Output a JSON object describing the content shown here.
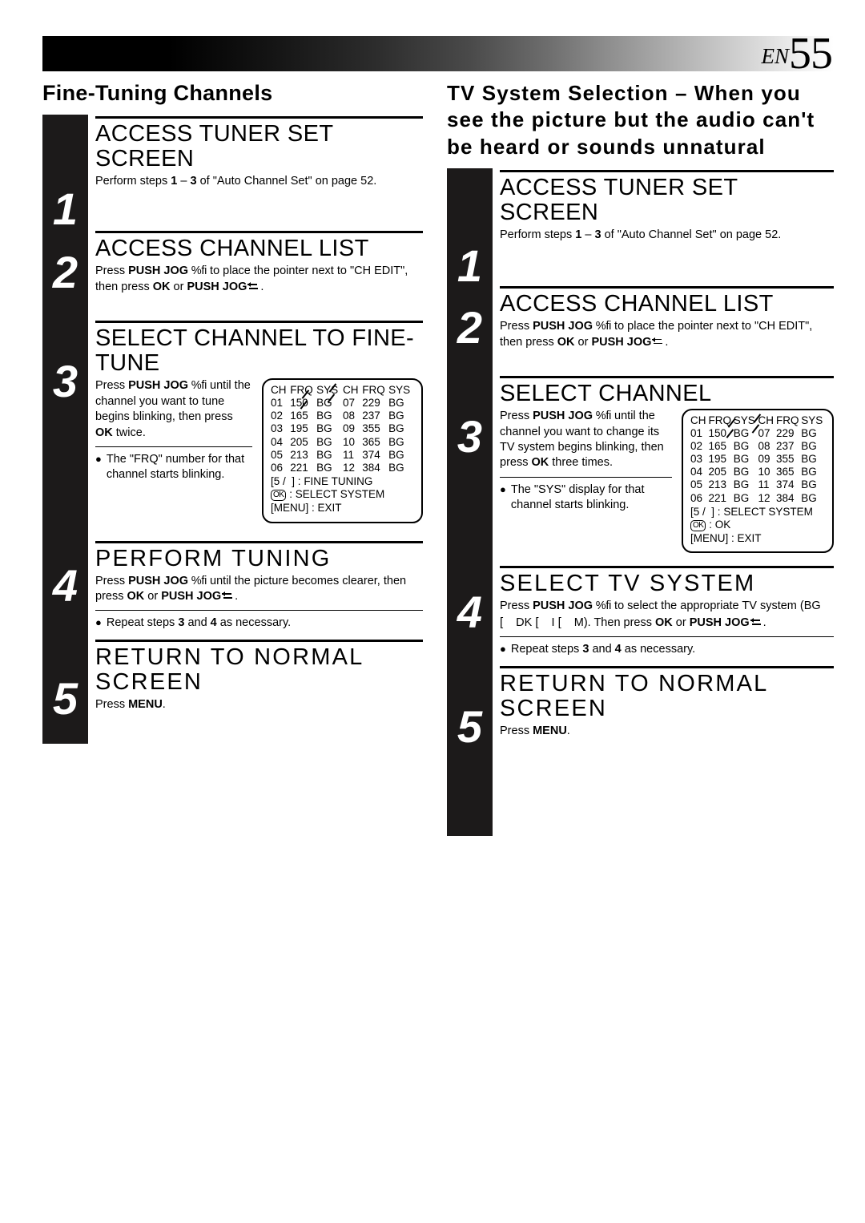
{
  "header": {
    "lang_code": "EN",
    "page_number": "55"
  },
  "columns": {
    "left": {
      "title": "Fine-Tuning Channels",
      "steps": [
        {
          "number": "1",
          "heading": "ACCESS TUNER SET SCREEN",
          "text_parts": {
            "a": "Perform steps ",
            "b": "1",
            "c": " – ",
            "d": "3",
            "e": " of \"Auto Channel Set\" on page 52."
          }
        },
        {
          "number": "2",
          "heading": "ACCESS CHANNEL LIST",
          "text_parts": {
            "a": "Press ",
            "b": "PUSH JOG",
            "c": " %fi",
            "d": " to place the pointer next to \"CH EDIT\", then press ",
            "e": "OK",
            "f": " or ",
            "g": "PUSH JOG",
            "h": "."
          }
        },
        {
          "number": "3",
          "heading": "SELECT CHANNEL TO FINE-TUNE",
          "text_parts": {
            "a": "Press ",
            "b": "PUSH JOG",
            "c": " %fi",
            "d": " until the channel you want to tune begins blinking, then press ",
            "e": "OK",
            "f": " twice."
          },
          "bullet": "The \"FRQ\" number for that channel starts blinking."
        },
        {
          "number": "4",
          "heading": "PERFORM TUNING",
          "text_parts": {
            "a": "Press ",
            "b": "PUSH JOG",
            "c": " %fi",
            "d": " until the picture becomes clearer, then press ",
            "e": "OK",
            "f": " or ",
            "g": "PUSH JOG",
            "h": "."
          },
          "bullet_parts": {
            "a": "Repeat steps ",
            "b": "3",
            "c": " and ",
            "d": "4",
            "e": " as necessary."
          }
        },
        {
          "number": "5",
          "heading": "RETURN TO NORMAL SCREEN",
          "text_parts": {
            "a": "Press ",
            "b": "MENU",
            "c": "."
          }
        }
      ]
    },
    "right": {
      "title": "TV System Selection – When you see the picture but the audio can't be heard or sounds unnatural",
      "steps": [
        {
          "number": "1",
          "heading": "ACCESS TUNER SET SCREEN",
          "text_parts": {
            "a": "Perform steps ",
            "b": "1",
            "c": " – ",
            "d": "3",
            "e": " of \"Auto Channel Set\" on page 52."
          }
        },
        {
          "number": "2",
          "heading": "ACCESS CHANNEL LIST",
          "text_parts": {
            "a": "Press ",
            "b": "PUSH JOG",
            "c": " %fi",
            "d": " to place the pointer next to \"CH EDIT\", then press ",
            "e": "OK",
            "f": " or ",
            "g": "PUSH JOG",
            "h": "."
          }
        },
        {
          "number": "3",
          "heading": "SELECT CHANNEL",
          "text_parts": {
            "a": "Press ",
            "b": "PUSH JOG",
            "c": " %fi",
            "d": " until the channel you want to change its TV system begins blinking, then press ",
            "e": "OK",
            "f": " three times."
          },
          "bullet": "The \"SYS\" display for that channel starts blinking."
        },
        {
          "number": "4",
          "heading": "SELECT TV SYSTEM",
          "text_parts": {
            "a": "Press ",
            "b": "PUSH JOG",
            "c": " %fi",
            "d": " to select the appropriate TV system (BG ",
            "d2": "[",
            "d3": "DK ",
            "d4": "[",
            "d5": "I ",
            "d6": "[",
            "d7": "M). Then press ",
            "e": "OK",
            "f": " or ",
            "g": "PUSH JOG",
            "h": "."
          },
          "bullet_parts": {
            "a": "Repeat steps ",
            "b": "3",
            "c": " and ",
            "d": "4",
            "e": " as necessary."
          }
        },
        {
          "number": "5",
          "heading": "RETURN TO NORMAL SCREEN",
          "text_parts": {
            "a": "Press ",
            "b": "MENU",
            "c": "."
          }
        }
      ]
    }
  },
  "osd_left": {
    "headers": [
      "CH",
      "FRQ",
      "SYS",
      "CH",
      "FRQ",
      "SYS"
    ],
    "rows": [
      [
        "01",
        "150",
        "BG",
        "07",
        "229",
        "BG"
      ],
      [
        "02",
        "165",
        "BG",
        "08",
        "237",
        "BG"
      ],
      [
        "03",
        "195",
        "BG",
        "09",
        "355",
        "BG"
      ],
      [
        "04",
        "205",
        "BG",
        "10",
        "365",
        "BG"
      ],
      [
        "05",
        "213",
        "BG",
        "11",
        "374",
        "BG"
      ],
      [
        "06",
        "221",
        "BG",
        "12",
        "384",
        "BG"
      ]
    ],
    "legend": [
      {
        "key": "[5 /",
        "key2": "] :",
        "label": "FINE TUNING",
        "icon": ""
      },
      {
        "key": "",
        "key2": ":",
        "label": "SELECT SYSTEM",
        "icon": "OK"
      },
      {
        "key": "[MENU] :",
        "key2": "",
        "label": "EXIT",
        "icon": ""
      }
    ]
  },
  "osd_right": {
    "headers": [
      "CH",
      "FRQ",
      "SYS",
      "CH",
      "FRQ",
      "SYS"
    ],
    "rows": [
      [
        "01",
        "150",
        "BG",
        "07",
        "229",
        "BG"
      ],
      [
        "02",
        "165",
        "BG",
        "08",
        "237",
        "BG"
      ],
      [
        "03",
        "195",
        "BG",
        "09",
        "355",
        "BG"
      ],
      [
        "04",
        "205",
        "BG",
        "10",
        "365",
        "BG"
      ],
      [
        "05",
        "213",
        "BG",
        "11",
        "374",
        "BG"
      ],
      [
        "06",
        "221",
        "BG",
        "12",
        "384",
        "BG"
      ]
    ],
    "legend": [
      {
        "key": "[5 /",
        "key2": "] :",
        "label": "SELECT SYSTEM",
        "icon": ""
      },
      {
        "key": "",
        "key2": ":",
        "label": "OK",
        "icon": "OK"
      },
      {
        "key": "[MENU] :",
        "key2": "",
        "label": "EXIT",
        "icon": ""
      }
    ]
  }
}
